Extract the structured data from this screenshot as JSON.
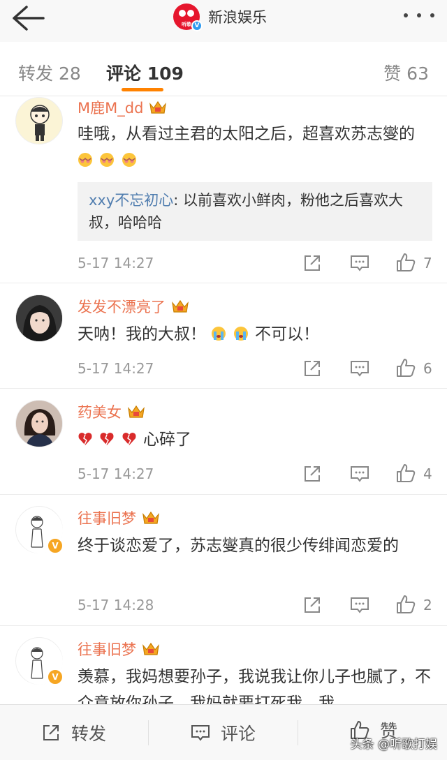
{
  "header": {
    "title": "新浪娱乐",
    "logo_text": "听歌",
    "verified_mark": "V"
  },
  "tabs": {
    "repost": "转发 28",
    "comment": "评论 109",
    "like": "赞 63"
  },
  "comments": [
    {
      "name": "M鹿M_dd",
      "text": "哇哦，从看过主君的太阳之后，超喜欢苏志燮的",
      "emoji": [
        "shy-face-emoji",
        "shy-face-emoji",
        "shy-face-emoji"
      ],
      "reply": {
        "name": "xxy不忘初心",
        "text": ": 以前喜欢小鲜肉，粉他之后喜欢大叔，哈哈哈"
      },
      "time": "5-17 14:27",
      "likes": "7"
    },
    {
      "name": "发发不漂亮了",
      "text_before": "天呐！我的大叔！",
      "emoji": [
        "crying-face-emoji",
        "crying-face-emoji"
      ],
      "text_after": "不可以！",
      "time": "5-17 14:27",
      "likes": "6"
    },
    {
      "name": "药美女",
      "emoji": [
        "broken-heart-emoji",
        "broken-heart-emoji",
        "broken-heart-emoji"
      ],
      "text": "心碎了",
      "time": "5-17 14:27",
      "likes": "4"
    },
    {
      "name": "往事旧梦",
      "text": "终于谈恋爱了，苏志燮真的很少传绯闻恋爱的",
      "time": "5-17 14:28",
      "likes": "2"
    },
    {
      "name": "往事旧梦",
      "text": "羡慕，我妈想要孙子，我说我让你儿子也腻了，不介意放你孙子。我妈就要打死我，我"
    }
  ],
  "bottom": {
    "repost": "转发",
    "comment": "评论",
    "like": "赞"
  },
  "watermark": "头条 @听歌打娱",
  "colors": {
    "accent": "#ff8200",
    "username": "#eb7350",
    "reply_name": "#507daf"
  }
}
